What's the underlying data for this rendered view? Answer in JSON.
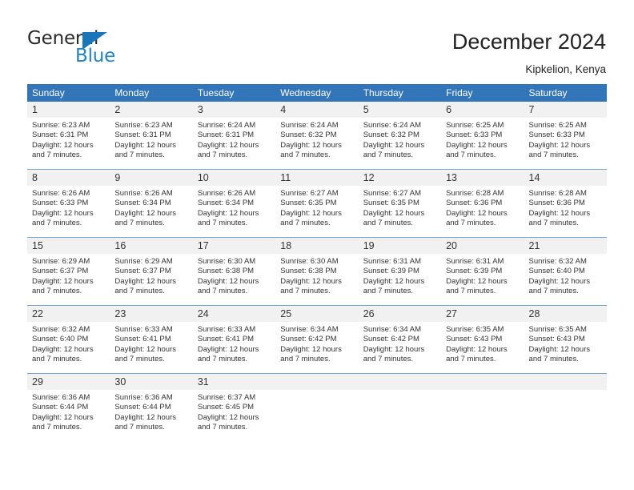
{
  "logo": {
    "word_top": "General",
    "word_bottom": "Blue",
    "triangle_icon": "triangle-icon",
    "color_blue": "#1b75bb",
    "color_text": "#2b2b2b"
  },
  "header": {
    "title": "December 2024",
    "subtitle": "Kipkelion, Kenya"
  },
  "theme": {
    "header_bg": "#3275b8",
    "header_text": "#ffffff",
    "daynum_bg": "#f1f1f1",
    "separator": "#7ba7d0"
  },
  "calendar": {
    "weekdays": [
      "Sunday",
      "Monday",
      "Tuesday",
      "Wednesday",
      "Thursday",
      "Friday",
      "Saturday"
    ],
    "weeks": [
      [
        {
          "day": "1",
          "sunrise": "Sunrise: 6:23 AM",
          "sunset": "Sunset: 6:31 PM",
          "daylight_1": "Daylight: 12 hours",
          "daylight_2": "and 7 minutes."
        },
        {
          "day": "2",
          "sunrise": "Sunrise: 6:23 AM",
          "sunset": "Sunset: 6:31 PM",
          "daylight_1": "Daylight: 12 hours",
          "daylight_2": "and 7 minutes."
        },
        {
          "day": "3",
          "sunrise": "Sunrise: 6:24 AM",
          "sunset": "Sunset: 6:31 PM",
          "daylight_1": "Daylight: 12 hours",
          "daylight_2": "and 7 minutes."
        },
        {
          "day": "4",
          "sunrise": "Sunrise: 6:24 AM",
          "sunset": "Sunset: 6:32 PM",
          "daylight_1": "Daylight: 12 hours",
          "daylight_2": "and 7 minutes."
        },
        {
          "day": "5",
          "sunrise": "Sunrise: 6:24 AM",
          "sunset": "Sunset: 6:32 PM",
          "daylight_1": "Daylight: 12 hours",
          "daylight_2": "and 7 minutes."
        },
        {
          "day": "6",
          "sunrise": "Sunrise: 6:25 AM",
          "sunset": "Sunset: 6:33 PM",
          "daylight_1": "Daylight: 12 hours",
          "daylight_2": "and 7 minutes."
        },
        {
          "day": "7",
          "sunrise": "Sunrise: 6:25 AM",
          "sunset": "Sunset: 6:33 PM",
          "daylight_1": "Daylight: 12 hours",
          "daylight_2": "and 7 minutes."
        }
      ],
      [
        {
          "day": "8",
          "sunrise": "Sunrise: 6:26 AM",
          "sunset": "Sunset: 6:33 PM",
          "daylight_1": "Daylight: 12 hours",
          "daylight_2": "and 7 minutes."
        },
        {
          "day": "9",
          "sunrise": "Sunrise: 6:26 AM",
          "sunset": "Sunset: 6:34 PM",
          "daylight_1": "Daylight: 12 hours",
          "daylight_2": "and 7 minutes."
        },
        {
          "day": "10",
          "sunrise": "Sunrise: 6:26 AM",
          "sunset": "Sunset: 6:34 PM",
          "daylight_1": "Daylight: 12 hours",
          "daylight_2": "and 7 minutes."
        },
        {
          "day": "11",
          "sunrise": "Sunrise: 6:27 AM",
          "sunset": "Sunset: 6:35 PM",
          "daylight_1": "Daylight: 12 hours",
          "daylight_2": "and 7 minutes."
        },
        {
          "day": "12",
          "sunrise": "Sunrise: 6:27 AM",
          "sunset": "Sunset: 6:35 PM",
          "daylight_1": "Daylight: 12 hours",
          "daylight_2": "and 7 minutes."
        },
        {
          "day": "13",
          "sunrise": "Sunrise: 6:28 AM",
          "sunset": "Sunset: 6:36 PM",
          "daylight_1": "Daylight: 12 hours",
          "daylight_2": "and 7 minutes."
        },
        {
          "day": "14",
          "sunrise": "Sunrise: 6:28 AM",
          "sunset": "Sunset: 6:36 PM",
          "daylight_1": "Daylight: 12 hours",
          "daylight_2": "and 7 minutes."
        }
      ],
      [
        {
          "day": "15",
          "sunrise": "Sunrise: 6:29 AM",
          "sunset": "Sunset: 6:37 PM",
          "daylight_1": "Daylight: 12 hours",
          "daylight_2": "and 7 minutes."
        },
        {
          "day": "16",
          "sunrise": "Sunrise: 6:29 AM",
          "sunset": "Sunset: 6:37 PM",
          "daylight_1": "Daylight: 12 hours",
          "daylight_2": "and 7 minutes."
        },
        {
          "day": "17",
          "sunrise": "Sunrise: 6:30 AM",
          "sunset": "Sunset: 6:38 PM",
          "daylight_1": "Daylight: 12 hours",
          "daylight_2": "and 7 minutes."
        },
        {
          "day": "18",
          "sunrise": "Sunrise: 6:30 AM",
          "sunset": "Sunset: 6:38 PM",
          "daylight_1": "Daylight: 12 hours",
          "daylight_2": "and 7 minutes."
        },
        {
          "day": "19",
          "sunrise": "Sunrise: 6:31 AM",
          "sunset": "Sunset: 6:39 PM",
          "daylight_1": "Daylight: 12 hours",
          "daylight_2": "and 7 minutes."
        },
        {
          "day": "20",
          "sunrise": "Sunrise: 6:31 AM",
          "sunset": "Sunset: 6:39 PM",
          "daylight_1": "Daylight: 12 hours",
          "daylight_2": "and 7 minutes."
        },
        {
          "day": "21",
          "sunrise": "Sunrise: 6:32 AM",
          "sunset": "Sunset: 6:40 PM",
          "daylight_1": "Daylight: 12 hours",
          "daylight_2": "and 7 minutes."
        }
      ],
      [
        {
          "day": "22",
          "sunrise": "Sunrise: 6:32 AM",
          "sunset": "Sunset: 6:40 PM",
          "daylight_1": "Daylight: 12 hours",
          "daylight_2": "and 7 minutes."
        },
        {
          "day": "23",
          "sunrise": "Sunrise: 6:33 AM",
          "sunset": "Sunset: 6:41 PM",
          "daylight_1": "Daylight: 12 hours",
          "daylight_2": "and 7 minutes."
        },
        {
          "day": "24",
          "sunrise": "Sunrise: 6:33 AM",
          "sunset": "Sunset: 6:41 PM",
          "daylight_1": "Daylight: 12 hours",
          "daylight_2": "and 7 minutes."
        },
        {
          "day": "25",
          "sunrise": "Sunrise: 6:34 AM",
          "sunset": "Sunset: 6:42 PM",
          "daylight_1": "Daylight: 12 hours",
          "daylight_2": "and 7 minutes."
        },
        {
          "day": "26",
          "sunrise": "Sunrise: 6:34 AM",
          "sunset": "Sunset: 6:42 PM",
          "daylight_1": "Daylight: 12 hours",
          "daylight_2": "and 7 minutes."
        },
        {
          "day": "27",
          "sunrise": "Sunrise: 6:35 AM",
          "sunset": "Sunset: 6:43 PM",
          "daylight_1": "Daylight: 12 hours",
          "daylight_2": "and 7 minutes."
        },
        {
          "day": "28",
          "sunrise": "Sunrise: 6:35 AM",
          "sunset": "Sunset: 6:43 PM",
          "daylight_1": "Daylight: 12 hours",
          "daylight_2": "and 7 minutes."
        }
      ],
      [
        {
          "day": "29",
          "sunrise": "Sunrise: 6:36 AM",
          "sunset": "Sunset: 6:44 PM",
          "daylight_1": "Daylight: 12 hours",
          "daylight_2": "and 7 minutes."
        },
        {
          "day": "30",
          "sunrise": "Sunrise: 6:36 AM",
          "sunset": "Sunset: 6:44 PM",
          "daylight_1": "Daylight: 12 hours",
          "daylight_2": "and 7 minutes."
        },
        {
          "day": "31",
          "sunrise": "Sunrise: 6:37 AM",
          "sunset": "Sunset: 6:45 PM",
          "daylight_1": "Daylight: 12 hours",
          "daylight_2": "and 7 minutes."
        },
        {
          "day": "",
          "sunrise": "",
          "sunset": "",
          "daylight_1": "",
          "daylight_2": ""
        },
        {
          "day": "",
          "sunrise": "",
          "sunset": "",
          "daylight_1": "",
          "daylight_2": ""
        },
        {
          "day": "",
          "sunrise": "",
          "sunset": "",
          "daylight_1": "",
          "daylight_2": ""
        },
        {
          "day": "",
          "sunrise": "",
          "sunset": "",
          "daylight_1": "",
          "daylight_2": ""
        }
      ]
    ]
  }
}
